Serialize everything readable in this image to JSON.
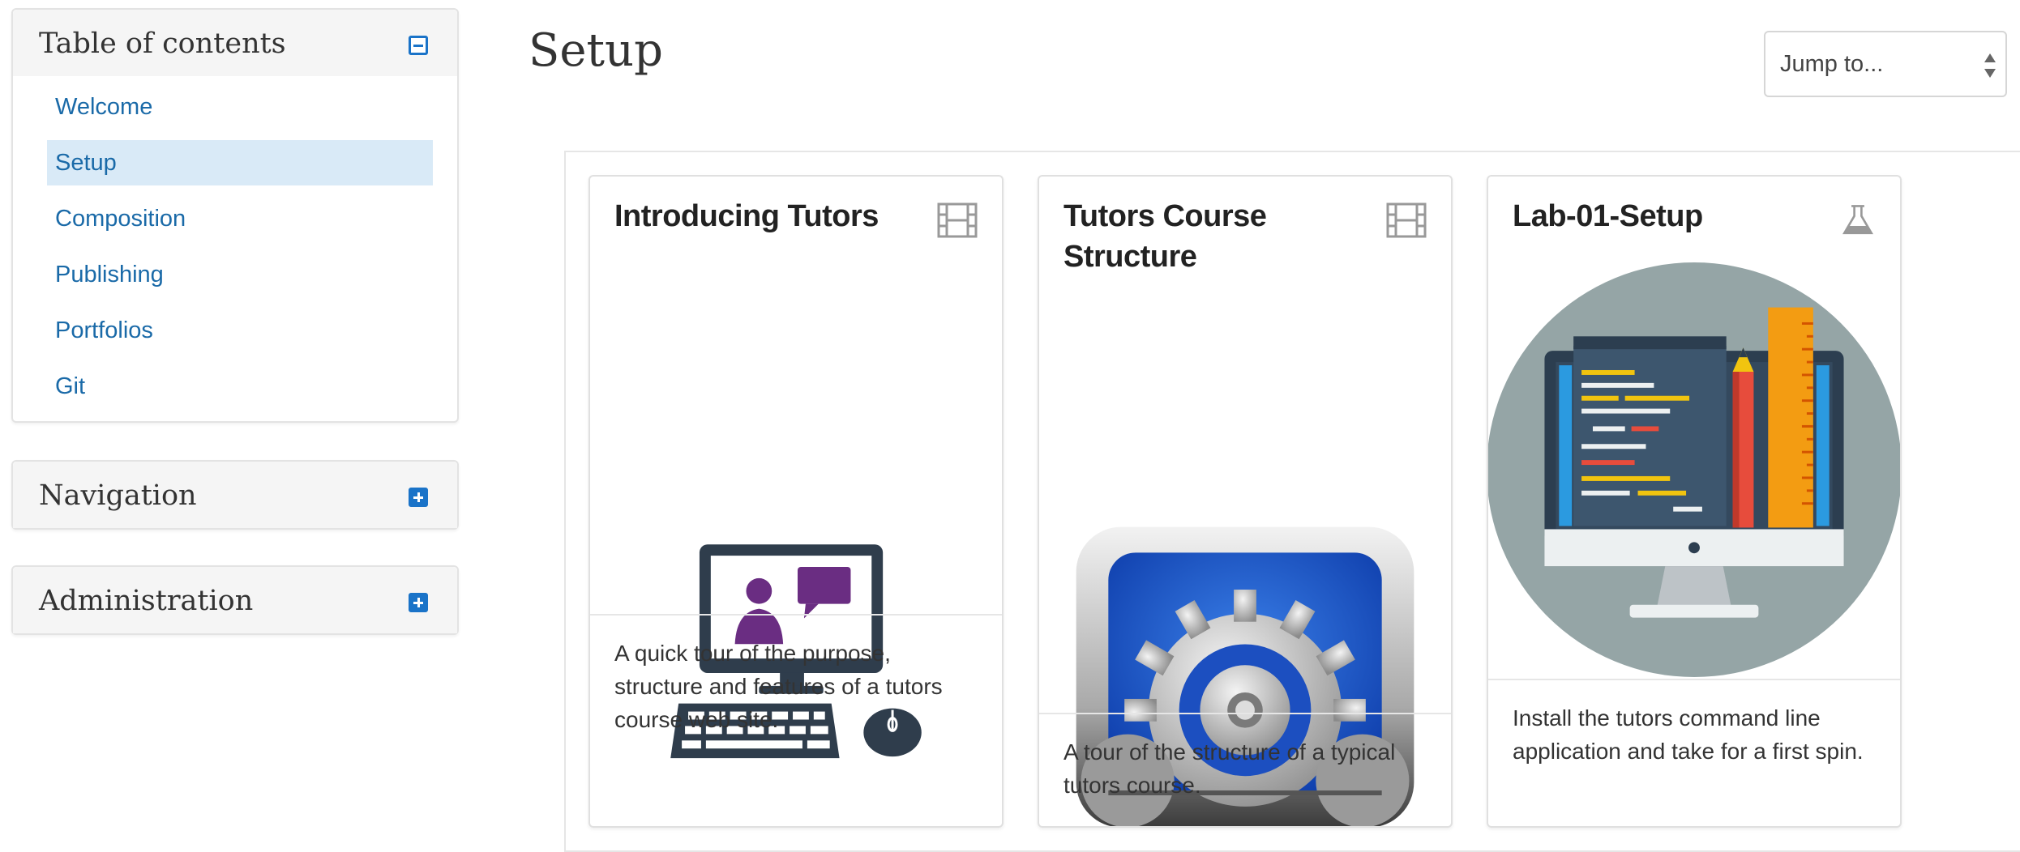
{
  "sidebar": {
    "toc": {
      "title": "Table of contents",
      "items": [
        {
          "label": "Welcome",
          "active": false
        },
        {
          "label": "Setup",
          "active": true
        },
        {
          "label": "Composition",
          "active": false
        },
        {
          "label": "Publishing",
          "active": false
        },
        {
          "label": "Portfolios",
          "active": false
        },
        {
          "label": "Git",
          "active": false
        }
      ]
    },
    "navigation": {
      "title": "Navigation"
    },
    "administration": {
      "title": "Administration"
    }
  },
  "main": {
    "title": "Setup",
    "jump_select": {
      "value": "Jump to..."
    },
    "cards": [
      {
        "title": "Introducing Tutors",
        "type_icon": "film-icon",
        "description": "A quick tour of the purpose, structure and features of a tutors course web site."
      },
      {
        "title": "Tutors Course Structure",
        "type_icon": "film-icon",
        "description": "A tour of the structure of a typical tutors course."
      },
      {
        "title": "Lab-01-Setup",
        "type_icon": "flask-icon",
        "description": "Install the tutors command line application and take for a first spin."
      }
    ]
  },
  "colors": {
    "link": "#1a6aa8",
    "active_bg": "#d9eaf7",
    "toggle": "#1a73c8"
  }
}
